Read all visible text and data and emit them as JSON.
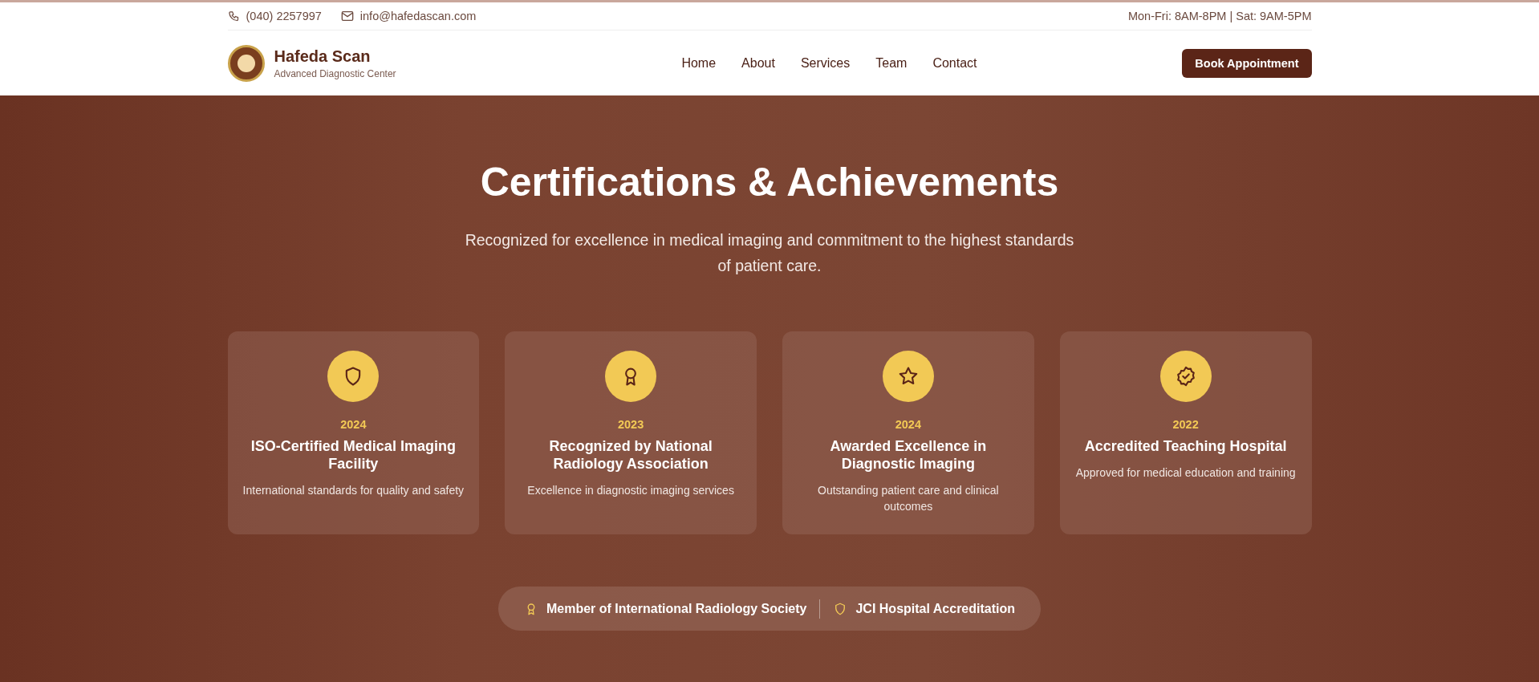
{
  "top_bar": {
    "phone": "(040) 2257997",
    "email": "info@hafedascan.com",
    "hours": "Mon-Fri: 8AM-8PM | Sat: 9AM-5PM"
  },
  "header": {
    "brand": "Hafeda Scan",
    "tagline": "Advanced Diagnostic Center",
    "nav": [
      "Home",
      "About",
      "Services",
      "Team",
      "Contact"
    ],
    "cta": "Book Appointment"
  },
  "hero": {
    "title": "Certifications & Achievements",
    "subtitle": "Recognized for excellence in medical imaging and commitment to the highest standards of patient care."
  },
  "cards": [
    {
      "kind": "shield",
      "year": "2024",
      "title": "ISO-Certified Medical Imaging Facility",
      "description": "International standards for quality and safety"
    },
    {
      "kind": "award",
      "year": "2023",
      "title": "Recognized by National Radiology Association",
      "description": "Excellence in diagnostic imaging services"
    },
    {
      "kind": "star",
      "year": "2024",
      "title": "Awarded Excellence in Diagnostic Imaging",
      "description": "Outstanding patient care and clinical outcomes"
    },
    {
      "kind": "badge",
      "year": "2022",
      "title": "Accredited Teaching Hospital",
      "description": "Approved for medical education and training"
    }
  ],
  "memberships": [
    {
      "kind": "award",
      "label": "Member of International Radiology Society"
    },
    {
      "kind": "shield",
      "label": "JCI Hospital Accreditation"
    }
  ]
}
